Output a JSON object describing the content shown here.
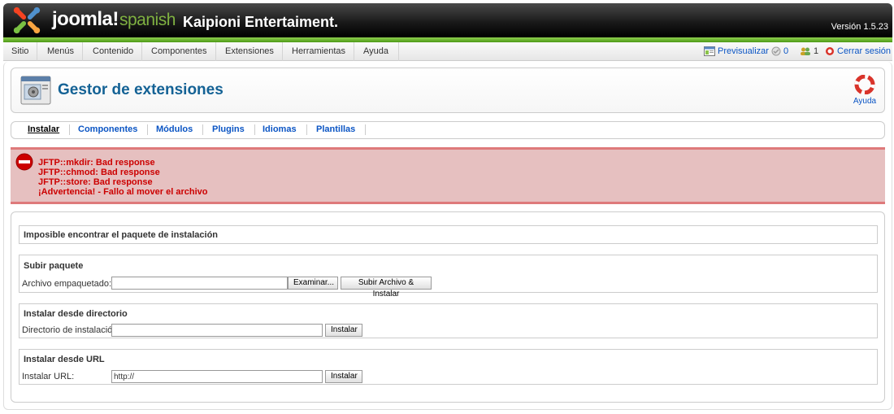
{
  "header": {
    "brand": "joomla!",
    "brand_sub": "spanish",
    "site_name": "Kaipioni Entertaiment.",
    "version": "Versión 1.5.23"
  },
  "menu": {
    "items": [
      {
        "label": "Sitio"
      },
      {
        "label": "Menús"
      },
      {
        "label": "Contenido"
      },
      {
        "label": "Componentes"
      },
      {
        "label": "Extensiones"
      },
      {
        "label": "Herramientas"
      },
      {
        "label": "Ayuda"
      }
    ],
    "preview": "Previsualizar",
    "messages_count": "0",
    "users_count": "1",
    "logout": "Cerrar sesión"
  },
  "page": {
    "title": "Gestor de extensiones",
    "help": "Ayuda"
  },
  "submenu": [
    {
      "label": "Instalar"
    },
    {
      "label": "Componentes"
    },
    {
      "label": "Módulos"
    },
    {
      "label": "Plugins"
    },
    {
      "label": "Idiomas"
    },
    {
      "label": "Plantillas"
    }
  ],
  "errors": [
    "JFTP::mkdir: Bad response",
    "JFTP::chmod: Bad response",
    "JFTP::store: Bad response",
    "¡Advertencia! - Fallo al mover el archivo"
  ],
  "install": {
    "notice": "Imposible encontrar el paquete de instalación",
    "upload": {
      "title": "Subir paquete",
      "label": "Archivo empaquetado:",
      "value": "",
      "browse": "Examinar...",
      "submit": "Subir Archivo & Instalar"
    },
    "directory": {
      "title": "Instalar desde directorio",
      "label": "Directorio de instalación:",
      "value": "",
      "submit": "Instalar"
    },
    "url": {
      "title": "Instalar desde URL",
      "label": "Instalar URL:",
      "value": "http://",
      "submit": "Instalar"
    }
  },
  "colors": {
    "header_bg": "#000000",
    "accent_green": "#7fb141",
    "link_blue": "#0b55c4",
    "title_blue": "#146295",
    "error_bg": "#e6c0c0",
    "error_text": "#cc0000"
  }
}
